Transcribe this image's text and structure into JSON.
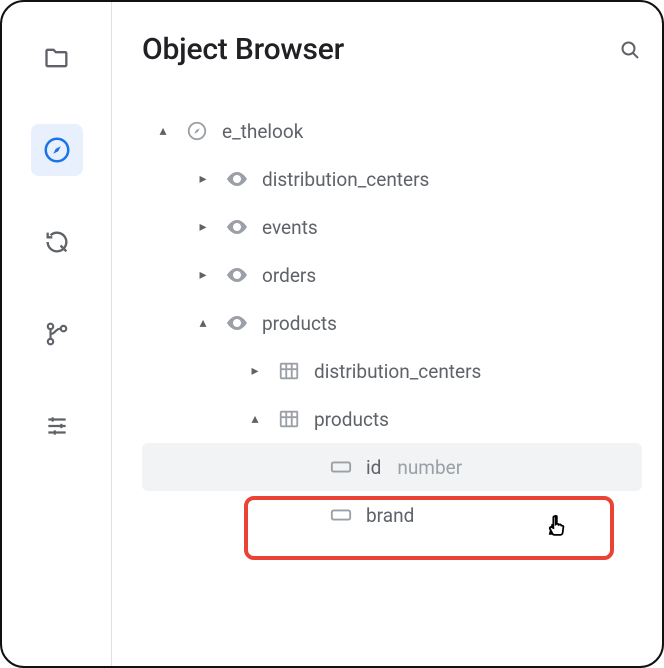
{
  "header": {
    "title": "Object Browser"
  },
  "sidebar": {
    "items": [
      {
        "name": "folder-icon",
        "active": false
      },
      {
        "name": "compass-icon",
        "active": true
      },
      {
        "name": "refresh-icon",
        "active": false
      },
      {
        "name": "git-icon",
        "active": false
      },
      {
        "name": "settings-icon",
        "active": false
      }
    ]
  },
  "tree": {
    "root": {
      "label": "e_thelook",
      "expanded": true,
      "children": [
        {
          "label": "distribution_centers",
          "icon": "eye",
          "expanded": false
        },
        {
          "label": "events",
          "icon": "eye",
          "expanded": false
        },
        {
          "label": "orders",
          "icon": "eye",
          "expanded": false
        },
        {
          "label": "products",
          "icon": "eye",
          "expanded": true,
          "children": [
            {
              "label": "distribution_centers",
              "icon": "table",
              "expanded": false
            },
            {
              "label": "products",
              "icon": "table",
              "expanded": true,
              "children": [
                {
                  "label": "id",
                  "type": "number",
                  "icon": "field"
                },
                {
                  "label": "brand",
                  "icon": "field"
                }
              ]
            }
          ]
        }
      ]
    }
  }
}
